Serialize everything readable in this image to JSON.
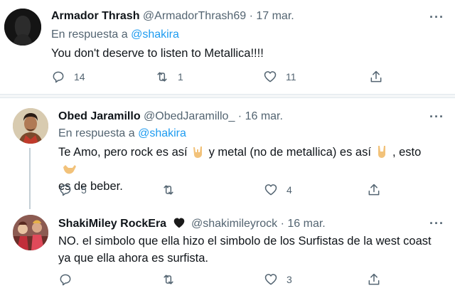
{
  "tweets": [
    {
      "name": "Armador Thrash",
      "handle": "@ArmadorThrash69",
      "dot": "·",
      "date": "17 mar.",
      "reply_prefix": "En respuesta a",
      "reply_to": "@shakira",
      "text": "You don't deserve to listen to Metallica!!!!",
      "replies": "14",
      "retweets": "1",
      "likes": "11"
    },
    {
      "name": "Obed Jaramillo",
      "handle": "@ObedJaramillo_",
      "dot": "·",
      "date": "16 mar.",
      "reply_prefix": "En respuesta a",
      "reply_to": "@shakira",
      "text_part1": "Te Amo, pero rock es así",
      "text_part2": "y metal (no de metallica) es así",
      "text_part3": ", esto",
      "text_line2": "es de beber.",
      "replies": "5",
      "retweets": "",
      "likes": "4"
    },
    {
      "name": "ShakiMiley RockEra",
      "handle": "@shakimileyrock",
      "dot": "·",
      "date": "16 mar.",
      "text_line1": "NO. el simbolo que ella hizo el simbolo de los Surfistas de la west coast",
      "text_line2": "ya que ella ahora es surfista.",
      "replies": "",
      "retweets": "",
      "likes": "3"
    }
  ],
  "more_label": "···",
  "colors": {
    "accent": "#1d9bf0",
    "secondary": "#536471"
  }
}
